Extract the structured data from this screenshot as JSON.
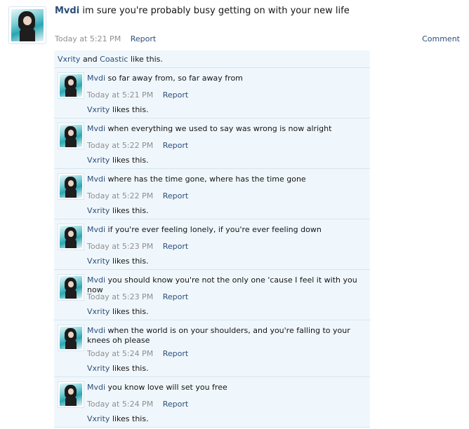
{
  "post": {
    "author": "Mvdi",
    "message": "im sure you're probably busy getting on with your new life",
    "time": "Today at 5:21 PM",
    "report_label": "Report",
    "comment_label": "Comment"
  },
  "likes_summary": {
    "user1": "Vxrity",
    "and": "and",
    "user2": "Coastic",
    "suffix": "like this."
  },
  "comments": [
    {
      "author": "Mvdi",
      "text": "so far away from, so far away from",
      "time": "Today at 5:21 PM",
      "report": "Report",
      "liker": "Vxrity",
      "likes_suffix": "likes this."
    },
    {
      "author": "Mvdi",
      "text": "when everything we used to say was wrong is now alright",
      "time": "Today at 5:22 PM",
      "report": "Report",
      "liker": "Vxrity",
      "likes_suffix": "likes this."
    },
    {
      "author": "Mvdi",
      "text": "where has the time gone, where has the time gone",
      "time": "Today at 5:22 PM",
      "report": "Report",
      "liker": "Vxrity",
      "likes_suffix": "likes this."
    },
    {
      "author": "Mvdi",
      "text": "if you're ever feeling lonely, if you're ever feeling down",
      "time": "Today at 5:23 PM",
      "report": "Report",
      "liker": "Vxrity",
      "likes_suffix": "likes this."
    },
    {
      "author": "Mvdi",
      "text": "you should know you're not the only one 'cause I feel it with you now",
      "time": "Today at 5:23 PM",
      "report": "Report",
      "liker": "Vxrity",
      "likes_suffix": "likes this."
    },
    {
      "author": "Mvdi",
      "text": "when the world is on your shoulders, and you're falling to your knees oh please",
      "time": "Today at 5:24 PM",
      "report": "Report",
      "liker": "Vxrity",
      "likes_suffix": "likes this."
    },
    {
      "author": "Mvdi",
      "text": "you know love will set you free",
      "time": "Today at 5:24 PM",
      "report": "Report",
      "liker": "Vxrity",
      "likes_suffix": "likes this."
    }
  ]
}
